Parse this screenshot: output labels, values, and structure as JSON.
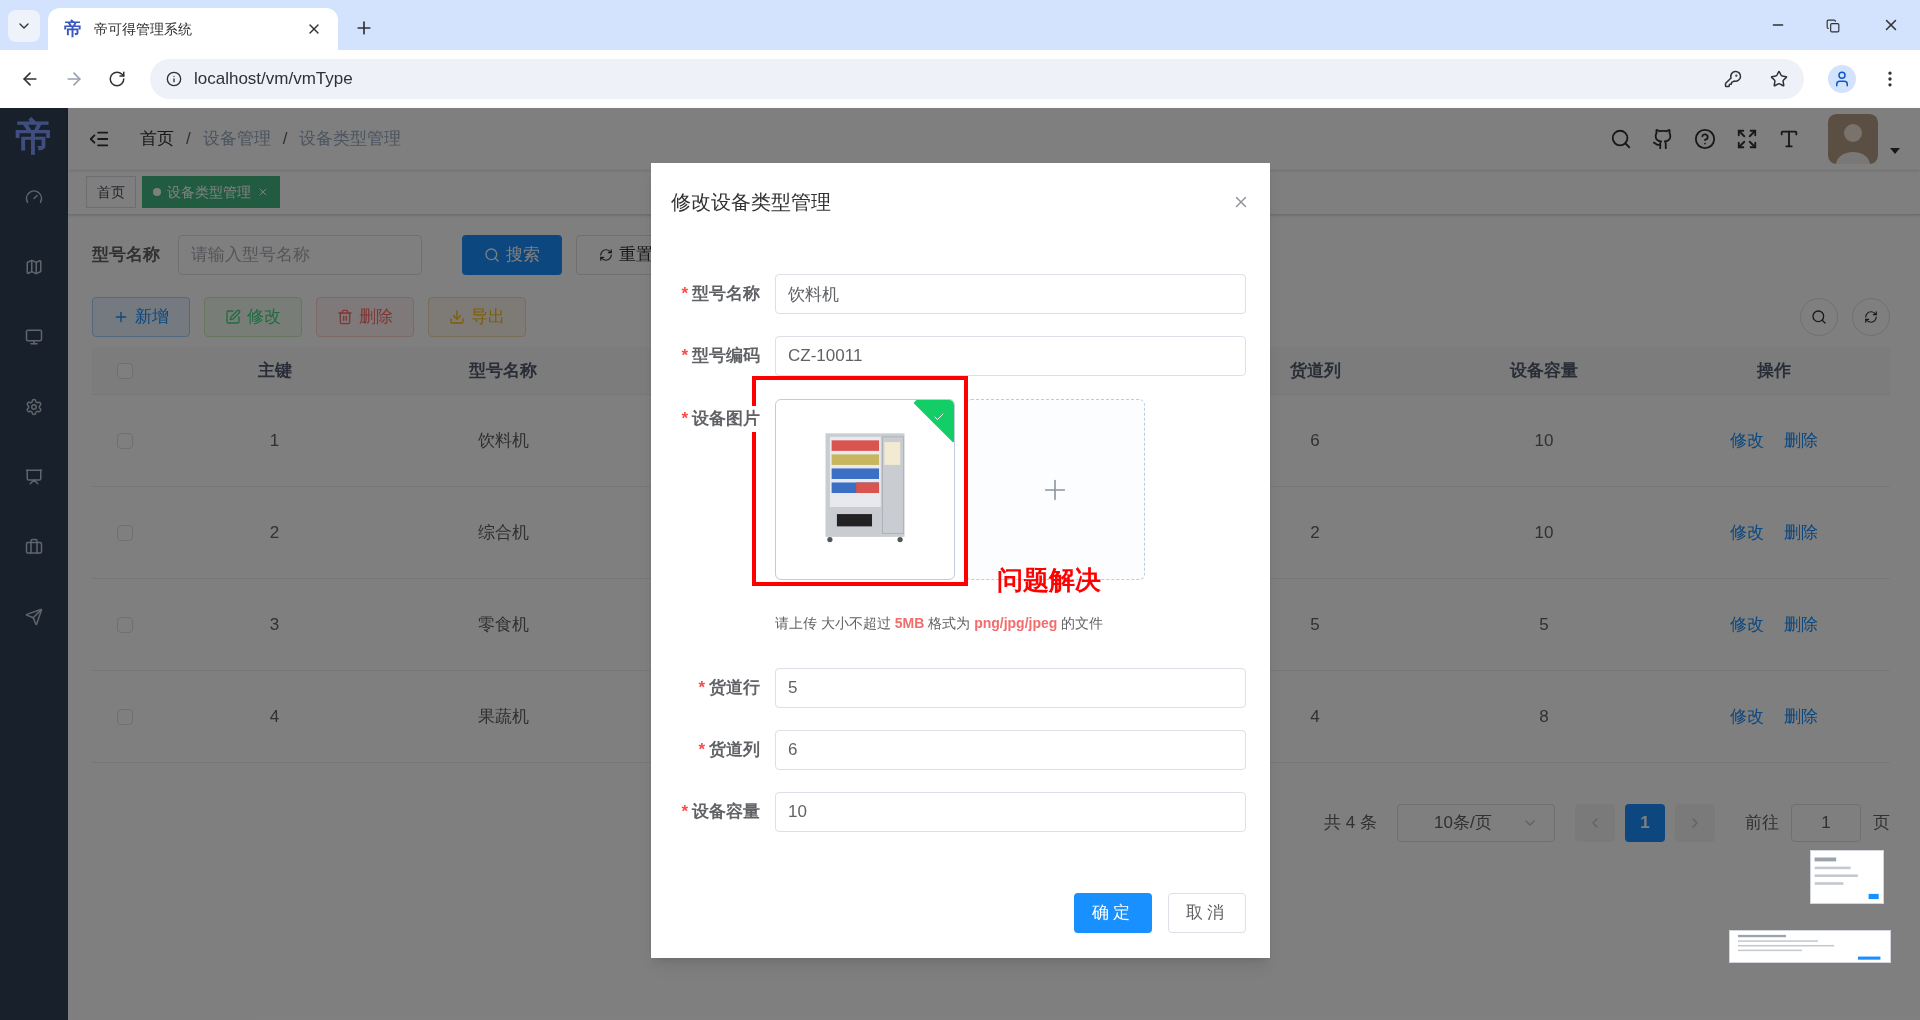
{
  "browser": {
    "favicon": "帝",
    "tab_title": "帝可得管理系统",
    "url": "localhost/vm/vmType"
  },
  "sidebar": {
    "logo": "帝"
  },
  "breadcrumbs": [
    {
      "label": "首页"
    },
    {
      "label": "设备管理",
      "separator": "/"
    },
    {
      "label": "设备类型管理",
      "separator": "/"
    }
  ],
  "tags": [
    {
      "label": "首页",
      "selected": false
    },
    {
      "label": "设备类型管理",
      "selected": true
    }
  ],
  "search": {
    "label": "型号名称",
    "placeholder": "请输入型号名称",
    "search_button": "搜索",
    "reset_button": "重置"
  },
  "toolbar": [
    {
      "label": "新增",
      "kind": "add",
      "disabled": false
    },
    {
      "label": "修改",
      "kind": "edit",
      "disabled": true
    },
    {
      "label": "删除",
      "kind": "delete",
      "disabled": true
    },
    {
      "label": "导出",
      "kind": "export",
      "disabled": false
    }
  ],
  "table": {
    "columns": [
      "主键",
      "型号名称",
      "货道列",
      "设备容量",
      "操作"
    ],
    "all_checked": false,
    "rows": [
      {
        "checked": false,
        "cells": [
          "1",
          "饮料机",
          "6",
          "10"
        ],
        "actions": [
          "修改",
          "删除"
        ]
      },
      {
        "checked": false,
        "cells": [
          "2",
          "综合机",
          "2",
          "10"
        ],
        "actions": [
          "修改",
          "删除"
        ]
      },
      {
        "checked": false,
        "cells": [
          "3",
          "零食机",
          "5",
          "5"
        ],
        "actions": [
          "修改",
          "删除"
        ]
      },
      {
        "checked": false,
        "cells": [
          "4",
          "果蔬机",
          "4",
          "8"
        ],
        "actions": [
          "修改",
          "删除"
        ]
      }
    ]
  },
  "pagination": {
    "total": "共 4 条",
    "page_size": "10条/页",
    "pages": [
      {
        "label": "1",
        "selected": true
      }
    ],
    "goto_label": "前往",
    "goto_value": "1",
    "goto_suffix": "页"
  },
  "dialog": {
    "title": "修改设备类型管理",
    "fields": [
      {
        "kind": "text",
        "label": "型号名称",
        "required_mark": "*",
        "value": "饮料机"
      },
      {
        "kind": "text",
        "label": "型号编码",
        "required_mark": "*",
        "value": "CZ-10011"
      },
      {
        "label": "设备图片",
        "required_mark": "*",
        "uploaded": true,
        "hint": "请上传 大小不超过 **5MB** 格式为 **png/jpg/jpeg** 的文件"
      },
      {
        "kind": "text",
        "label": "货道行",
        "required_mark": "*",
        "value": "5"
      },
      {
        "kind": "text",
        "label": "货道列",
        "required_mark": "*",
        "value": "6"
      },
      {
        "kind": "text",
        "label": "设备容量",
        "required_mark": "*",
        "value": "10"
      }
    ],
    "buttons": [
      {
        "label": "确定",
        "kind": "primary"
      },
      {
        "label": "取消",
        "kind": "default"
      }
    ],
    "annotation": {
      "text": "问题解决"
    }
  }
}
